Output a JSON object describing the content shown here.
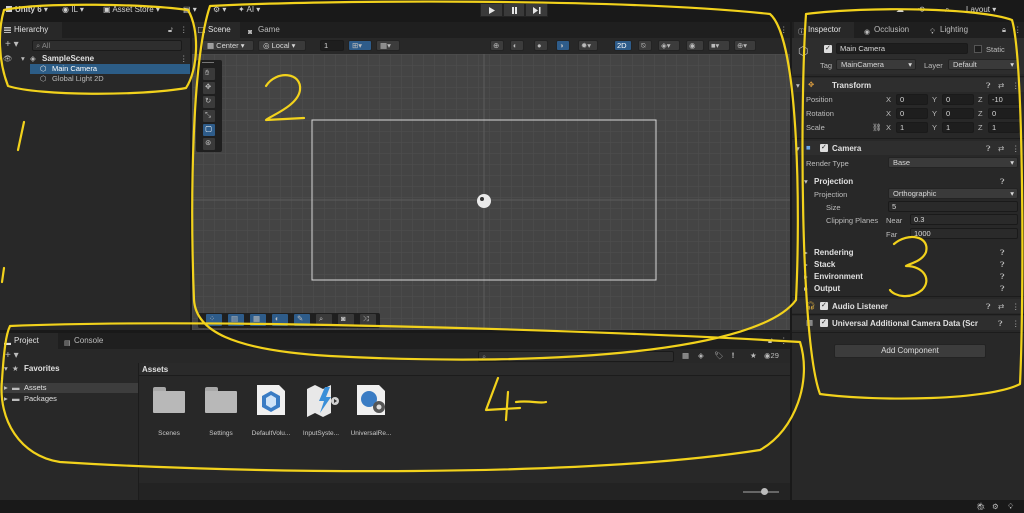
{
  "toolbar": {
    "account": "Unity 6",
    "user": "IL",
    "asset_store": "Asset Store",
    "layout": "Layout"
  },
  "hierarchy": {
    "tab": "Hierarchy",
    "search_placeholder": "All",
    "scene": "SampleScene",
    "items": [
      "Main Camera",
      "Global Light 2D"
    ]
  },
  "scene_view": {
    "tabs": [
      "Scene",
      "Game"
    ],
    "pivot": "Center",
    "space": "Local",
    "grid_snap": "1",
    "mode_2d": "2D"
  },
  "inspector": {
    "tabs": [
      "Inspector",
      "Occlusion",
      "Lighting"
    ],
    "object_name": "Main Camera",
    "static_label": "Static",
    "tag_label": "Tag",
    "tag_value": "MainCamera",
    "layer_label": "Layer",
    "layer_value": "Default",
    "transform": {
      "title": "Transform",
      "rows": [
        {
          "label": "Position",
          "x": "0",
          "y": "0",
          "z": "-10"
        },
        {
          "label": "Rotation",
          "x": "0",
          "y": "0",
          "z": "0"
        },
        {
          "label": "Scale",
          "x": "1",
          "y": "1",
          "z": "1"
        }
      ],
      "axis": [
        "X",
        "Y",
        "Z"
      ]
    },
    "camera": {
      "title": "Camera",
      "render_type_label": "Render Type",
      "render_type": "Base",
      "projection_section": "Projection",
      "projection_label": "Projection",
      "projection": "Orthographic",
      "size_label": "Size",
      "size": "5",
      "clipping_label": "Clipping Planes",
      "near_label": "Near",
      "near": "0.3",
      "far_label": "Far",
      "far": "1000",
      "sections": [
        "Rendering",
        "Stack",
        "Environment",
        "Output"
      ]
    },
    "audio_listener": "Audio Listener",
    "urp_data": "Universal Additional Camera Data (Scr",
    "add_component": "Add Component"
  },
  "project": {
    "tabs": [
      "Project",
      "Console"
    ],
    "favorites": "Favorites",
    "tree": [
      "Assets",
      "Packages"
    ],
    "breadcrumb": "Assets",
    "hidden_count": "29",
    "assets": [
      {
        "name": "Scenes",
        "icon": "folder-icon"
      },
      {
        "name": "Settings",
        "icon": "folder-icon"
      },
      {
        "name": "DefaultVolu...",
        "icon": "volume-profile-icon"
      },
      {
        "name": "InputSyste...",
        "icon": "input-actions-icon"
      },
      {
        "name": "UniversalRe...",
        "icon": "render-pipeline-asset-icon"
      }
    ]
  },
  "annotations": [
    "1",
    "2",
    "3",
    "4"
  ],
  "colors": {
    "selection": "#2c5d87",
    "scribble": "#f2d21c",
    "panel": "#282828",
    "background": "#191919"
  }
}
